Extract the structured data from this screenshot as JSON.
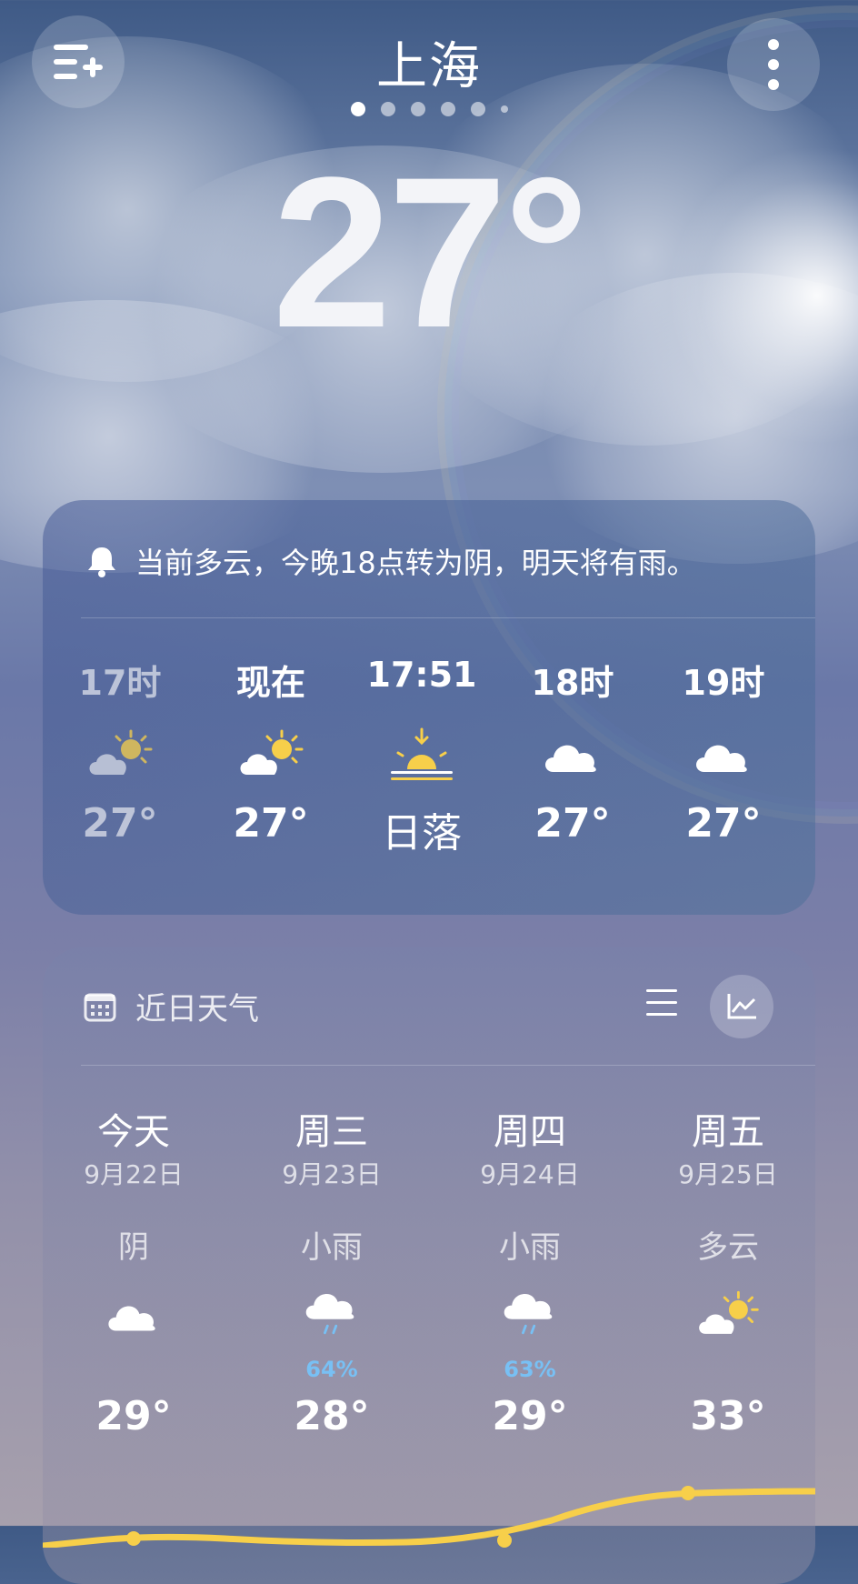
{
  "header": {
    "city": "上海",
    "menu_icon": "add-city-list-icon",
    "more_icon": "more-vertical-icon",
    "page_dots": 6,
    "active_page": 1
  },
  "current": {
    "temperature": "27°"
  },
  "hourly_card": {
    "alert_icon": "bell-icon",
    "alert_text": "当前多云，今晚18点转为阴，明天将有雨。",
    "hours": [
      {
        "time": "17时",
        "icon": "partly-cloudy-icon",
        "value": "27°",
        "dim": true
      },
      {
        "time": "现在",
        "icon": "partly-cloudy-icon",
        "value": "27°",
        "dim": false
      },
      {
        "time": "17:51",
        "icon": "sunset-icon",
        "value": "日落",
        "dim": false
      },
      {
        "time": "18时",
        "icon": "cloud-icon",
        "value": "27°",
        "dim": false
      },
      {
        "time": "19时",
        "icon": "cloud-icon",
        "value": "27°",
        "dim": false
      }
    ]
  },
  "daily_card": {
    "title": "近日天气",
    "title_icon": "calendar-icon",
    "list_view_icon": "list-view-icon",
    "chart_view_icon": "chart-view-icon",
    "days": [
      {
        "name": "今天",
        "date": "9月22日",
        "condition": "阴",
        "icon": "cloud-icon",
        "precip": "",
        "high": "29°"
      },
      {
        "name": "周三",
        "date": "9月23日",
        "condition": "小雨",
        "icon": "light-rain-icon",
        "precip": "64%",
        "high": "28°"
      },
      {
        "name": "周四",
        "date": "9月24日",
        "condition": "小雨",
        "icon": "light-rain-icon",
        "precip": "63%",
        "high": "29°"
      },
      {
        "name": "周五",
        "date": "9月25日",
        "condition": "多云",
        "icon": "partly-cloudy-icon",
        "precip": "",
        "high": "33°"
      }
    ]
  },
  "colors": {
    "accent_yellow": "#f7cf4a",
    "precip_blue": "#78c0f4"
  }
}
